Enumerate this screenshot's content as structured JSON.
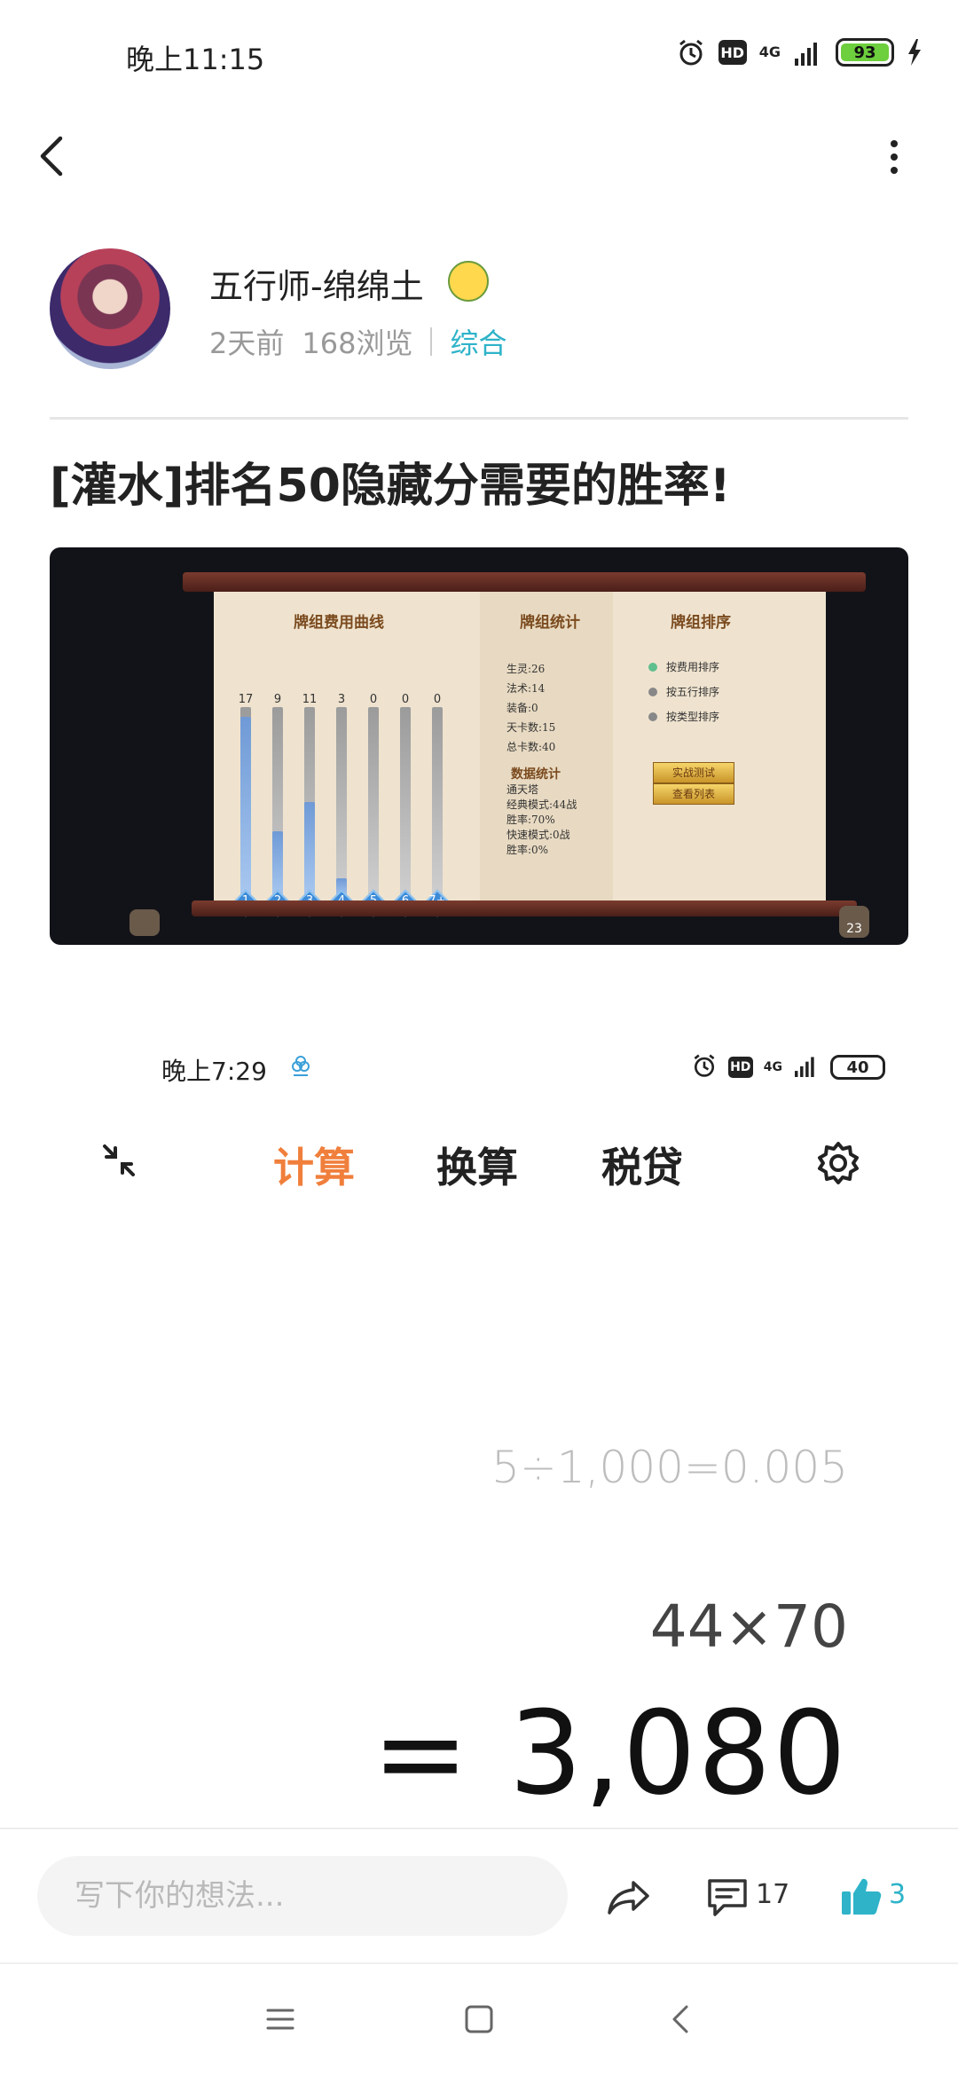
{
  "status_bar": {
    "time": "晚上11:15",
    "hd": "HD",
    "network": "4G",
    "battery": "93"
  },
  "post": {
    "author_name": "五行师-绵绵土",
    "time_ago": "2天前",
    "views": "168浏览",
    "category": "综合",
    "title": "[灌水]排名50隐藏分需要的胜率!"
  },
  "game_image": {
    "curve_title": "牌组费用曲线",
    "stats_title": "牌组统计",
    "sort_title": "牌组排序",
    "bars": [
      {
        "count": "17",
        "label": "1",
        "level": 0.95
      },
      {
        "count": "9",
        "label": "2",
        "level": 0.35
      },
      {
        "count": "11",
        "label": "3",
        "level": 0.5
      },
      {
        "count": "3",
        "label": "4",
        "level": 0.1
      },
      {
        "count": "0",
        "label": "5",
        "level": 0
      },
      {
        "count": "0",
        "label": "6",
        "level": 0
      },
      {
        "count": "0",
        "label": "7+",
        "level": 0
      }
    ],
    "deck_stats": [
      "生灵:26",
      "法术:14",
      "装备:0",
      "天卡数:15",
      "总卡数:40"
    ],
    "data_title": "数据统计",
    "data_stats": [
      "通天塔",
      "经典模式:44战",
      "胜率:70%",
      "快速模式:0战",
      "胜率:0%"
    ],
    "sort_options": [
      "按费用排序",
      "按五行排序",
      "按类型排序"
    ],
    "buttons": [
      "实战测试",
      "查看列表"
    ],
    "corner_badge": "23"
  },
  "calc_screenshot": {
    "time": "晚上7:29",
    "hd": "HD",
    "network": "4G",
    "battery": "40",
    "tabs": [
      "计算",
      "换算",
      "税贷"
    ],
    "history": "5÷1,000=0.005",
    "expression": "44×70",
    "result": "= 3,080"
  },
  "bottom_bar": {
    "comment_placeholder": "写下你的想法...",
    "comment_count": "17",
    "like_count": "3"
  },
  "colors": {
    "accent": "#2eb3c9",
    "tab_active": "#f07f3c",
    "battery_green": "#6dcf3d"
  }
}
